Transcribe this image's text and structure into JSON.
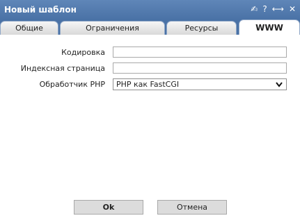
{
  "window": {
    "title": "Новый шаблон",
    "tools": {
      "pin": "✍",
      "help": "?",
      "resize": "⟷",
      "close": "✕"
    }
  },
  "tabs": [
    {
      "label": "Общие",
      "active": false
    },
    {
      "label": "Ограничения",
      "active": false
    },
    {
      "label": "Ресурсы",
      "active": false
    },
    {
      "label": "WWW",
      "active": true
    }
  ],
  "form": {
    "encoding": {
      "label": "Кодировка",
      "value": ""
    },
    "index_page": {
      "label": "Индексная страница",
      "value": ""
    },
    "php_handler": {
      "label": "Обработчик PHP",
      "selected": "PHP как FastCGI"
    }
  },
  "buttons": {
    "ok": "Ok",
    "cancel": "Отмена"
  },
  "colors": {
    "titlebar": "#4a72a6",
    "button_bg": "#dcdcdc"
  }
}
